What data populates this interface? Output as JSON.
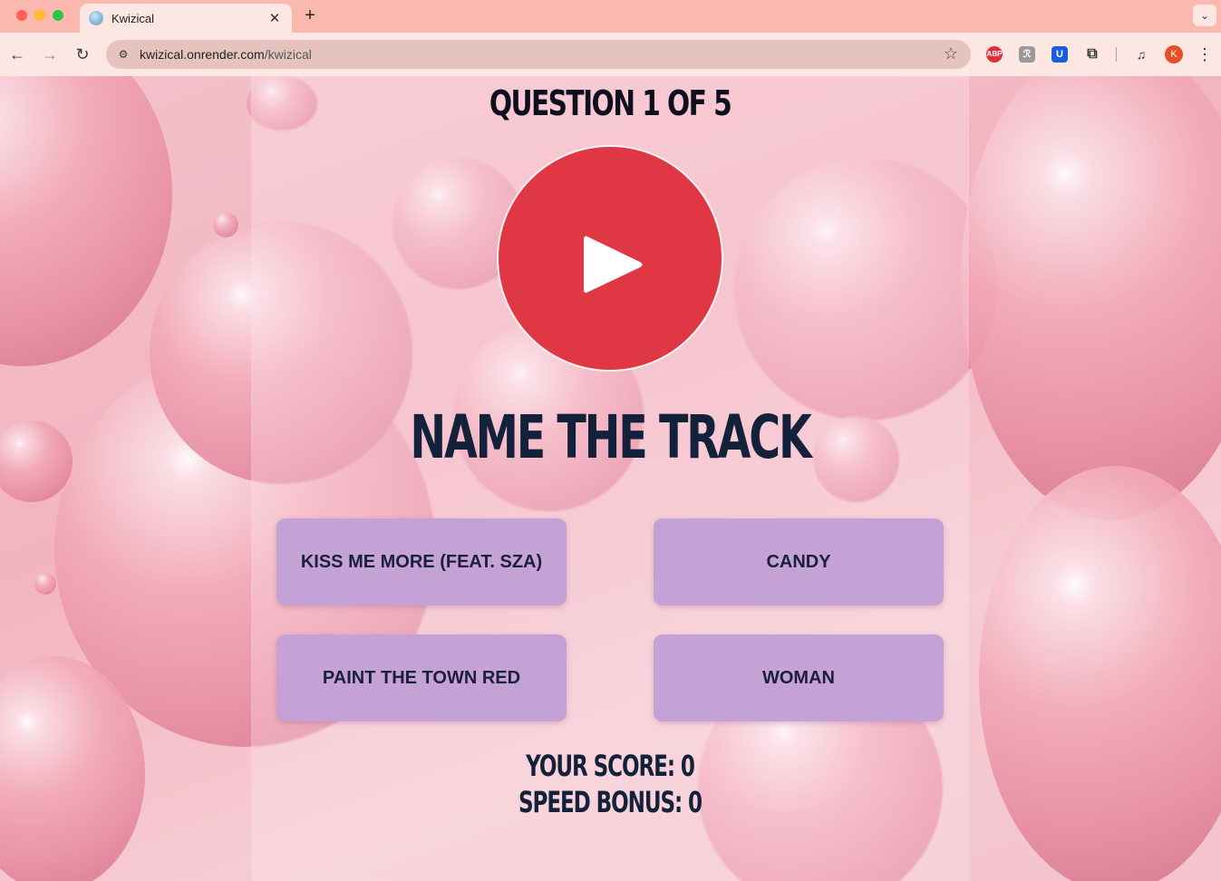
{
  "browser": {
    "tab_title": "Kwizical",
    "tab_close": "✕",
    "new_tab": "+",
    "tab_menu": "⌄",
    "url_host": "kwizical.onrender.com",
    "url_path": "/kwizical",
    "nav_back": "←",
    "nav_forward": "→",
    "nav_reload": "↻",
    "bookmark": "☆",
    "extensions": {
      "abp": "ABP",
      "grey": "ℛ",
      "bitwarden": "U",
      "puzzle": "⧉",
      "media": "♫"
    },
    "profile_initial": "K",
    "menu": "⋮"
  },
  "quiz": {
    "question_label": "QUESTION 1 OF 5",
    "heading": "NAME THE TRACK",
    "answers": [
      "KISS ME MORE (FEAT. SZA)",
      "CANDY",
      "PAINT THE TOWN RED",
      "WOMAN"
    ],
    "score_label": "YOUR SCORE: 0",
    "speed_bonus_label": "SPEED BONUS: 0",
    "play_icon": "play-icon"
  },
  "colors": {
    "play_button": "#df3844",
    "answer_bg": "#c5a2d5",
    "text_dark": "#13223a"
  }
}
